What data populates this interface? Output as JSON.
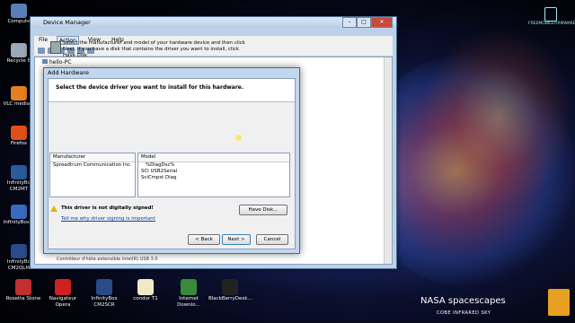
{
  "desktop": {
    "left_icons": [
      {
        "label": "Compute",
        "color": "#5a7fb8"
      },
      {
        "label": "Recycle B",
        "color": "#9aa8b8"
      },
      {
        "label": "VLC media p",
        "color": "#e67e22"
      },
      {
        "label": "Firefox",
        "color": "#e0501a"
      },
      {
        "label": "InfinityBo CM2MT",
        "color": "#2a5a9a"
      },
      {
        "label": "InfinityBox S",
        "color": "#3a6ac0"
      },
      {
        "label": "InfinityBo CM2QLM",
        "color": "#2a4a8a"
      }
    ],
    "bottom_icons": [
      {
        "label": "Rosetta Stone",
        "color": "#c03030"
      },
      {
        "label": "Navigateur Opera",
        "color": "#d02020"
      },
      {
        "label": "InfinityBox CM2SCR",
        "color": "#2a4a8a"
      },
      {
        "label": "condor T1",
        "color": "#f0e8c8"
      },
      {
        "label": "Internet Downlo...",
        "color": "#3a8a3a"
      },
      {
        "label": "BlackBerryDesk...",
        "color": "#222222"
      }
    ],
    "top_icon_labels": [
      "",
      "",
      "",
      "",
      "",
      ""
    ],
    "brand_logo": "FREEMOBILEFIRMWARE",
    "wallpaper_title": "NASA spacescapes",
    "wallpaper_subtitle": "COBE INFRARED SKY"
  },
  "device_manager": {
    "title": "Device Manager",
    "window_buttons": [
      "–",
      "□",
      "✕"
    ],
    "menu": [
      "File",
      "Action",
      "View",
      "Help"
    ],
    "active_menu": "Action",
    "tree_root": "hello-PC",
    "tree_bottom_item": "Contrôleur d'hôte extensible Intel(R) USB 3.0"
  },
  "add_hardware": {
    "title": "Add Hardware",
    "header": "Select the device driver you want to install for this hardware.",
    "info_text": "Select the manufacturer and model of your hardware device and then click Next. If you have a disk that contains the driver you want to install, click Have Disk.",
    "manufacturer_header": "Manufacturer",
    "manufacturers": [
      "Spreadtrum Communication Inc."
    ],
    "model_header": "Model",
    "models": [
      "%DiagDsc%",
      "SCI USB2Serial",
      "SciCmpst Diag"
    ],
    "warning_text": "This driver is not digitally signed!",
    "signing_link": "Tell me why driver signing is important",
    "have_disk_button": "Have Disk...",
    "back_button": "< Back",
    "next_button": "Next >",
    "cancel_button": "Cancel"
  }
}
